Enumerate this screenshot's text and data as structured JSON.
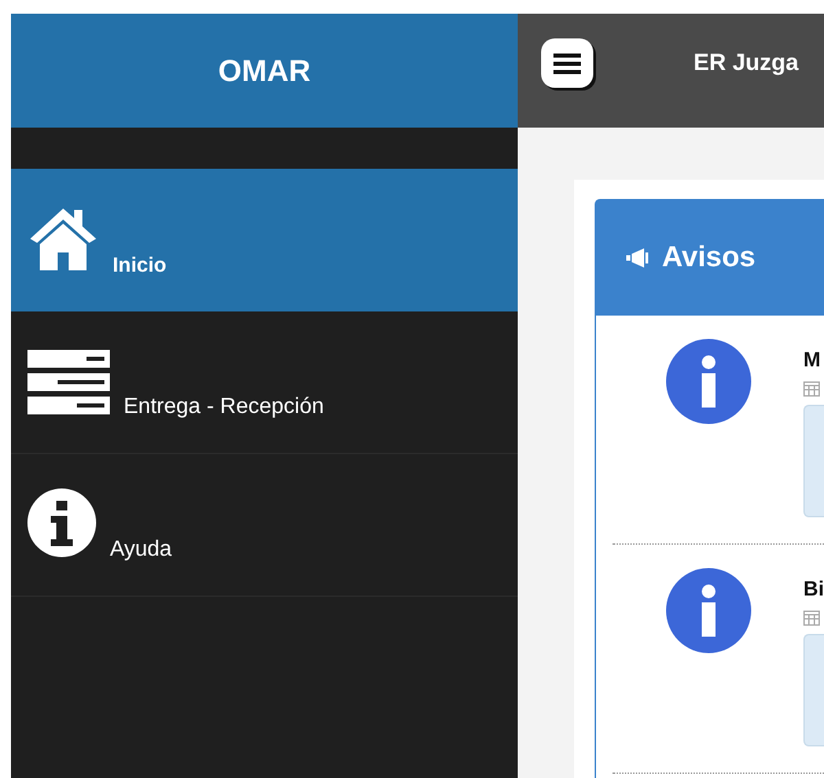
{
  "sidebar": {
    "brand": "OMAR",
    "items": [
      {
        "label": "Inicio",
        "kind": "home",
        "selected": true
      },
      {
        "label": "Entrega - Recepción",
        "kind": "server",
        "selected": false
      },
      {
        "label": "Ayuda",
        "kind": "info",
        "selected": false
      }
    ]
  },
  "topbar": {
    "title": "ER Juzga"
  },
  "panel": {
    "title": "Avisos",
    "notices": [
      {
        "title": "M"
      },
      {
        "title": "Bi"
      }
    ]
  }
}
